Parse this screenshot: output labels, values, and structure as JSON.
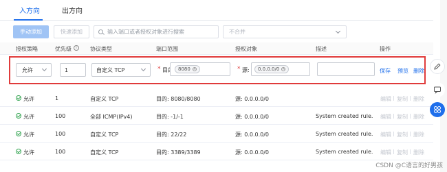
{
  "tabs": [
    {
      "label": "入方向",
      "active": true
    },
    {
      "label": "出方向",
      "active": false
    }
  ],
  "toolbar": {
    "manual_add_label": "手动添加",
    "quick_add_label": "快速添加",
    "search_placeholder": "输入端口或者授权对象进行搜索",
    "filter_placeholder": "不合并"
  },
  "table": {
    "columns": [
      "授权策略",
      "优先级",
      "协议类型",
      "端口范围",
      "授权对象",
      "描述",
      "操作"
    ],
    "priority_info_icon": "info-icon"
  },
  "edit_row": {
    "policy": "允许",
    "priority": "1",
    "protocol": "自定义 TCP",
    "port_label": "目的:",
    "port_tag": "8080",
    "source_label": "源:",
    "source_tag": "0.0.0.0/0",
    "description": "",
    "actions": [
      "保存",
      "预览",
      "删除"
    ]
  },
  "rows": [
    {
      "policy": "允许",
      "priority": "1",
      "protocol": "自定义 TCP",
      "port": "目的: 8080/8080",
      "source": "源: 0.0.0.0/0",
      "description": ""
    },
    {
      "policy": "允许",
      "priority": "100",
      "protocol": "全部 ICMP(IPv4)",
      "port": "目的: -1/-1",
      "source": "源: 0.0.0.0/0",
      "description": "System created rule."
    },
    {
      "policy": "允许",
      "priority": "100",
      "protocol": "自定义 TCP",
      "port": "目的: 22/22",
      "source": "源: 0.0.0.0/0",
      "description": "System created rule."
    },
    {
      "policy": "允许",
      "priority": "100",
      "protocol": "自定义 TCP",
      "port": "目的: 3389/3389",
      "source": "源: 0.0.0.0/0",
      "description": "System created rule."
    }
  ],
  "row_actions": [
    "编辑",
    "复制",
    "删除"
  ],
  "watermark": "CSDN @C语言的好男孩",
  "colors": {
    "accent": "#1f6feb",
    "highlight_border": "#e03b3b",
    "ok_green": "#3aa757",
    "side_button_blue": "#1f6feb"
  }
}
